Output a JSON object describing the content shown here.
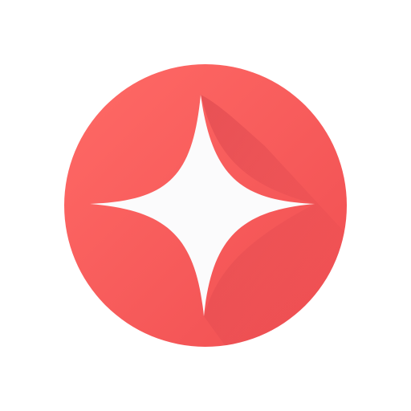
{
  "icon": {
    "name": "sparkle-app-icon",
    "symbol": "four-point-star-icon",
    "colors": {
      "background": "#ffffff",
      "circle_light": "#ff6a66",
      "circle_dark": "#f04e51",
      "shadow": "#d8444c",
      "star": "#fbfbfc"
    }
  }
}
